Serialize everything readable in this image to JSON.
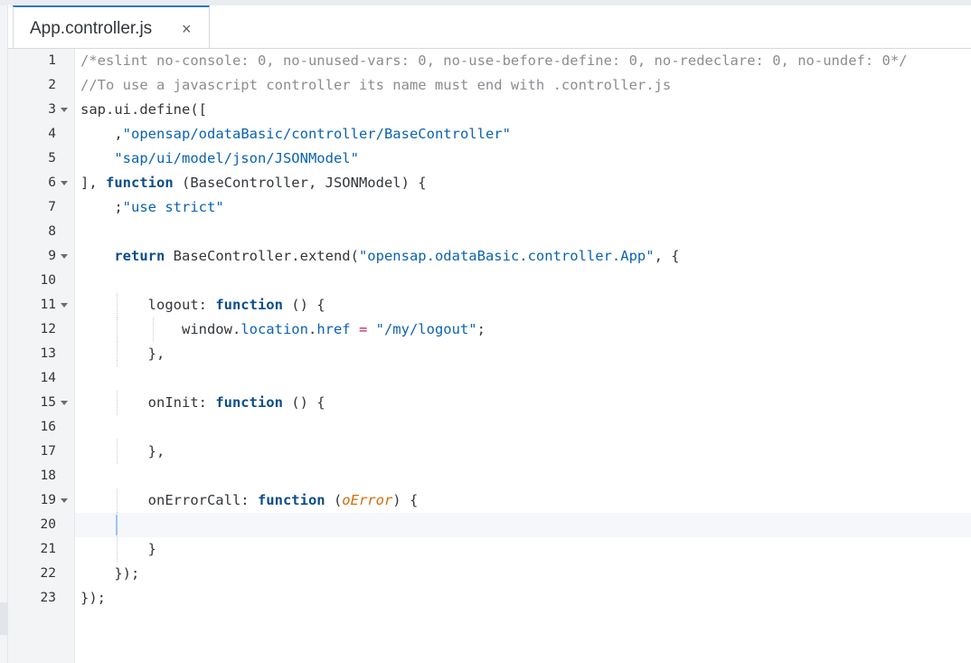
{
  "tab": {
    "title": "App.controller.js",
    "close_icon": "×"
  },
  "editor": {
    "line_numbers": [
      "1",
      "2",
      "3",
      "4",
      "5",
      "6",
      "7",
      "8",
      "9",
      "10",
      "11",
      "12",
      "13",
      "14",
      "15",
      "16",
      "17",
      "18",
      "19",
      "20",
      "21",
      "22",
      "23"
    ],
    "lines": [
      {
        "c": "/*eslint no-console: 0, no-unused-vars: 0, no-use-before-define: 0, no-redeclare: 0, no-undef: 0*/"
      },
      {
        "c": "//To use a javascript controller its name must end with .controller.js"
      },
      {
        "a": "sap.ui.define(["
      },
      {
        "a": "    ",
        "s": "\"opensap/odataBasic/controller/BaseController\"",
        "b": ","
      },
      {
        "a": "    ",
        "s": "\"sap/ui/model/json/JSONModel\""
      },
      {
        "a": "], ",
        "k": "function",
        "b": " (BaseController, JSONModel) {"
      },
      {
        "a": "    ",
        "s": "\"use strict\"",
        "b": ";"
      },
      {
        "a": ""
      },
      {
        "a": "    ",
        "k": "return",
        "b": " BaseController.extend(",
        "s": "\"opensap.odataBasic.controller.App\"",
        "e": ", {"
      },
      {
        "a": ""
      },
      {
        "a": "        logout: ",
        "k": "function",
        "b": " () {"
      },
      {
        "a": "            window.",
        "p": "location",
        "b": ".",
        "p2": "href",
        "o": " = ",
        "s": "\"/my/logout\"",
        "e": ";"
      },
      {
        "a": "        },"
      },
      {
        "a": ""
      },
      {
        "a": "        onInit: ",
        "k": "function",
        "b": " () {"
      },
      {
        "a": ""
      },
      {
        "a": "        },"
      },
      {
        "a": ""
      },
      {
        "a": "        onErrorCall: ",
        "k": "function",
        "b": " (",
        "pm": "oError",
        "e": ") {"
      },
      {
        "a": ""
      },
      {
        "a": "        }"
      },
      {
        "a": "    });"
      },
      {
        "a": "});"
      }
    ]
  }
}
